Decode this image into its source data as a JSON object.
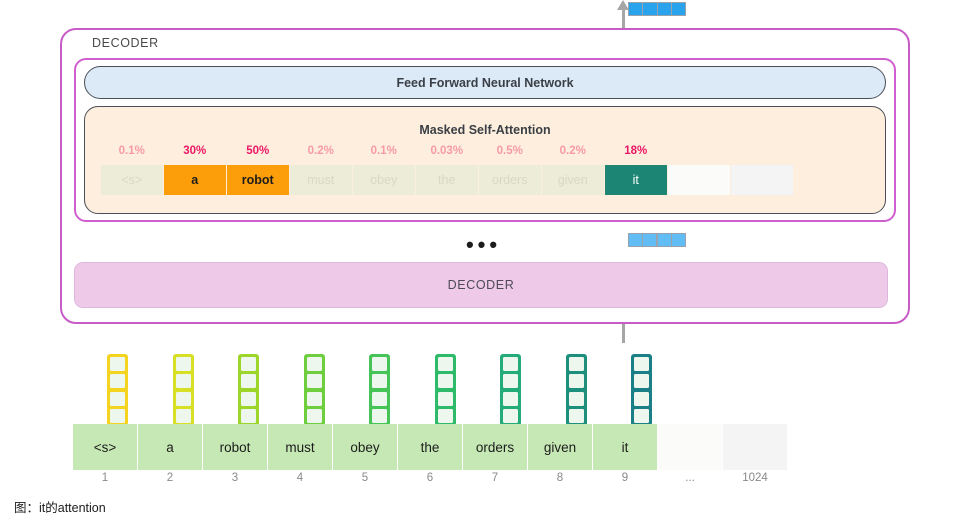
{
  "top_output_vector": {
    "name": "output-vector",
    "cells": 4,
    "color": "#29a3ec"
  },
  "mid_output_vector": {
    "name": "intermediate-vector",
    "cells": 4,
    "color": "#62bdf4"
  },
  "outer_decoder": {
    "label": "DECODER"
  },
  "feed_forward": {
    "label": "Feed Forward Neural Network"
  },
  "masked_self_attention": {
    "title": "Masked Self-Attention",
    "attention": [
      {
        "token": "<s>",
        "pct": "0.1%",
        "emphasis": "low",
        "state": "dim"
      },
      {
        "token": "a",
        "pct": "30%",
        "emphasis": "high",
        "state": "orange"
      },
      {
        "token": "robot",
        "pct": "50%",
        "emphasis": "high",
        "state": "orange"
      },
      {
        "token": "must",
        "pct": "0.2%",
        "emphasis": "low",
        "state": "dim"
      },
      {
        "token": "obey",
        "pct": "0.1%",
        "emphasis": "low",
        "state": "dim"
      },
      {
        "token": "the",
        "pct": "0.03%",
        "emphasis": "low",
        "state": "dim"
      },
      {
        "token": "orders",
        "pct": "0.5%",
        "emphasis": "low",
        "state": "dim"
      },
      {
        "token": "given",
        "pct": "0.2%",
        "emphasis": "low",
        "state": "dim"
      },
      {
        "token": "it",
        "pct": "18%",
        "emphasis": "high",
        "state": "teal"
      }
    ]
  },
  "ellipsis": "•••",
  "lower_decoder": {
    "label": "DECODER"
  },
  "embeddings": {
    "colors": [
      "#f5d321",
      "#d7e024",
      "#9ed52a",
      "#6fce3d",
      "#46c457",
      "#2dba69",
      "#23ab7a",
      "#1d8f7d",
      "#1a7f86"
    ]
  },
  "tokens": {
    "items": [
      "<s>",
      "a",
      "robot",
      "must",
      "obey",
      "the",
      "orders",
      "given",
      "it",
      "",
      ""
    ],
    "indices": [
      "1",
      "2",
      "3",
      "4",
      "5",
      "6",
      "7",
      "8",
      "9",
      "...",
      "1024"
    ]
  },
  "caption": "图：it的attention"
}
